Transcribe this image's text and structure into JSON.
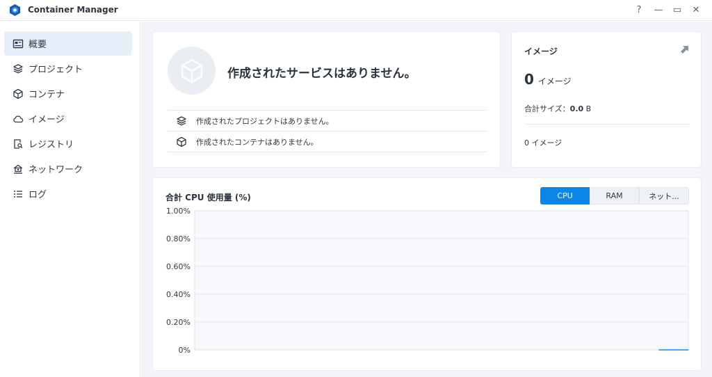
{
  "app": {
    "title": "Container Manager"
  },
  "window_controls": {
    "help": "?",
    "minimize": "—",
    "maximize": "▭",
    "close": "✕"
  },
  "sidebar": {
    "items": [
      {
        "label": "概要",
        "icon": "overview-icon",
        "active": true
      },
      {
        "label": "プロジェクト",
        "icon": "project-icon",
        "active": false
      },
      {
        "label": "コンテナ",
        "icon": "container-icon",
        "active": false
      },
      {
        "label": "イメージ",
        "icon": "image-cloud-icon",
        "active": false
      },
      {
        "label": "レジストリ",
        "icon": "registry-icon",
        "active": false
      },
      {
        "label": "ネットワーク",
        "icon": "network-icon",
        "active": false
      },
      {
        "label": "ログ",
        "icon": "log-icon",
        "active": false
      }
    ]
  },
  "services": {
    "title": "作成されたサービスはありません。",
    "rows": [
      {
        "icon": "project-icon",
        "label": "作成されたプロジェクトはありません。"
      },
      {
        "icon": "container-icon",
        "label": "作成されたコンテナはありません。"
      }
    ]
  },
  "images": {
    "title": "イメージ",
    "count": "0",
    "count_label": "イメージ",
    "size_label": "合計サイズ：",
    "size_value": "0.0",
    "size_unit": "B",
    "footer": "0 イメージ"
  },
  "cpu": {
    "title": "合計 CPU 使用量 (%)",
    "tabs": [
      {
        "label": "CPU",
        "active": true
      },
      {
        "label": "RAM",
        "active": false
      },
      {
        "label": "ネット...",
        "active": false
      }
    ]
  },
  "colors": {
    "accent": "#0a86e8",
    "active_nav_bg": "#e6f0fb",
    "main_bg": "#f2f4f7"
  },
  "chart_data": {
    "type": "line",
    "title": "合計 CPU 使用量 (%)",
    "xlabel": "",
    "ylabel": "",
    "y_ticks": [
      "1.00%",
      "0.80%",
      "0.60%",
      "0.40%",
      "0.20%",
      "0%"
    ],
    "ylim": [
      0,
      1.0
    ],
    "grid": true,
    "series": [
      {
        "color": "#0a86e8",
        "x": [
          0.94,
          1.0
        ],
        "values": [
          0,
          0
        ]
      }
    ]
  }
}
